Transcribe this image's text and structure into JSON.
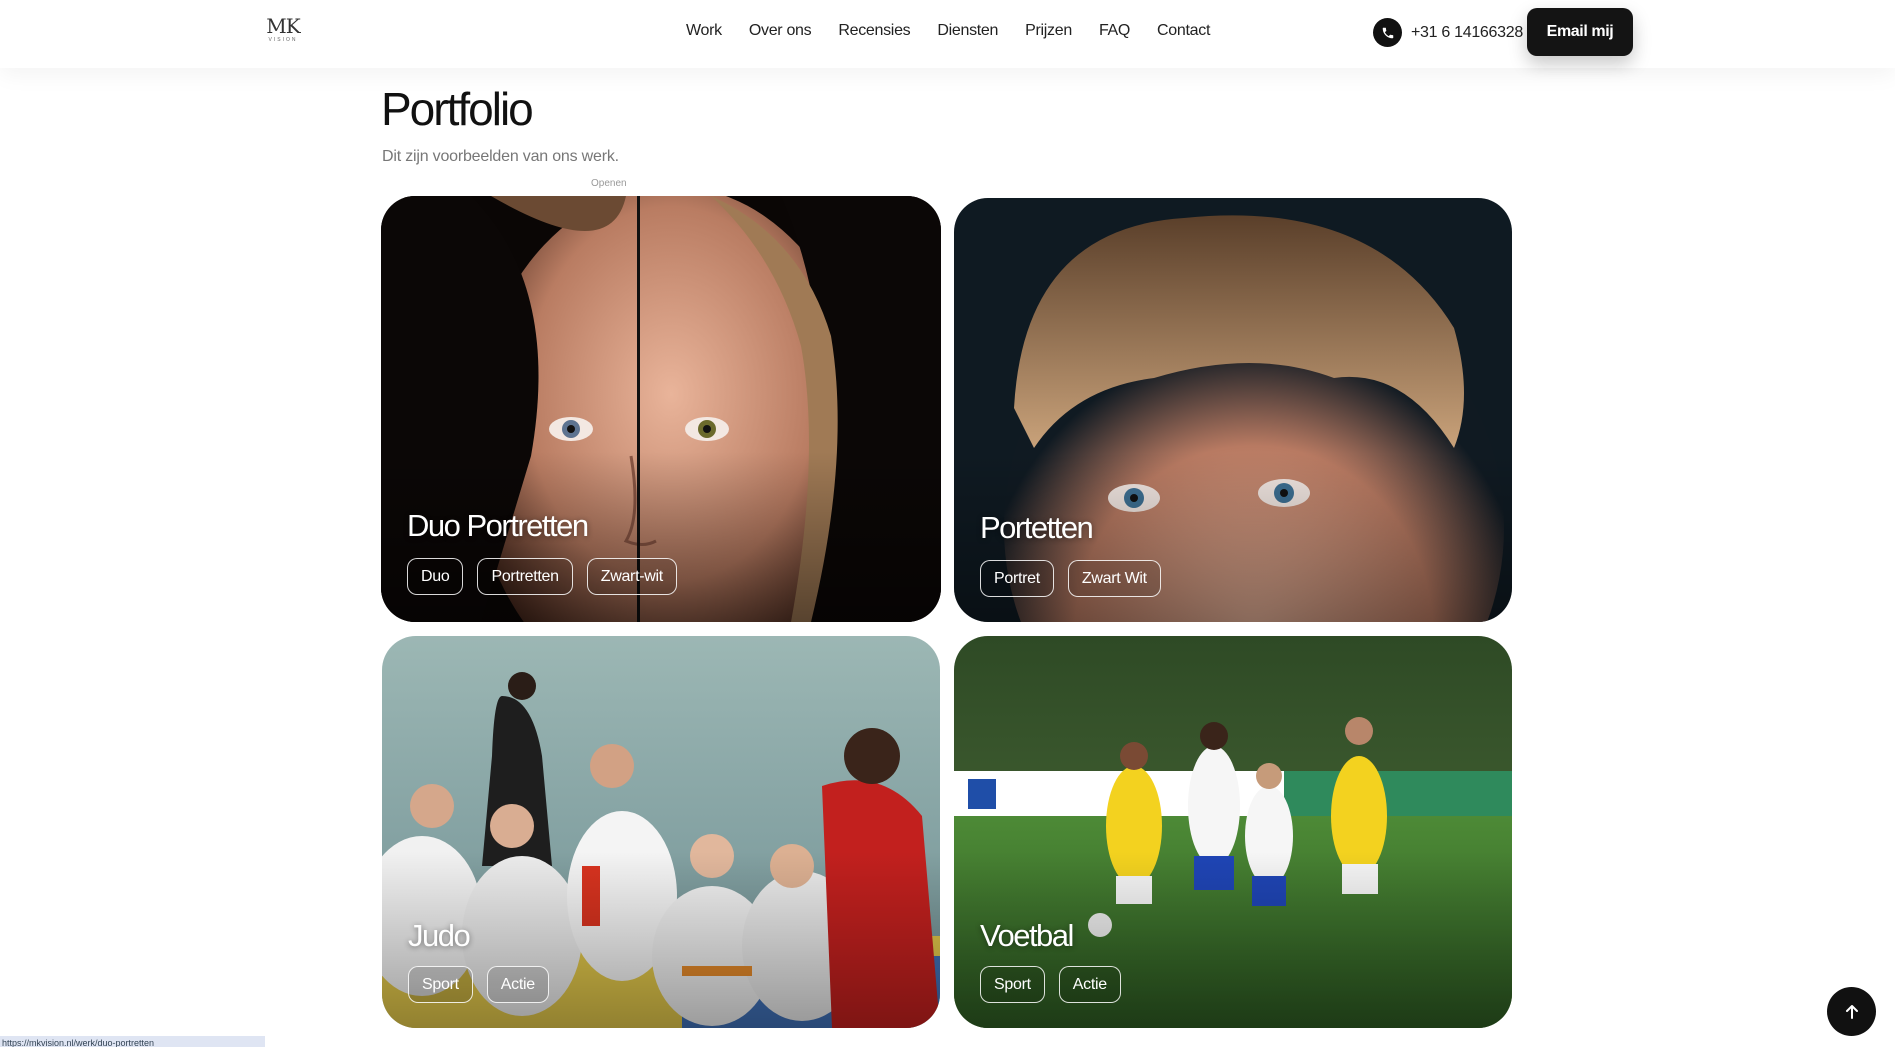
{
  "header": {
    "logo": "MK VISION",
    "nav": [
      "Work",
      "Over ons",
      "Recensies",
      "Diensten",
      "Prijzen",
      "FAQ",
      "Contact"
    ],
    "phone": "+31 6 14166328",
    "phone_icon": "phone-icon",
    "email_button": "Email mij"
  },
  "main": {
    "title": "Portfolio",
    "subtitle": "Dit zijn voorbeelden van ons werk.",
    "hover_hint": "Openen",
    "cards": [
      {
        "title": "Duo Portretten",
        "tags": [
          "Duo",
          "Portretten",
          "Zwart-wit"
        ]
      },
      {
        "title": "Portetten",
        "tags": [
          "Portret",
          "Zwart Wit"
        ]
      },
      {
        "title": "Judo",
        "tags": [
          "Sport",
          "Actie"
        ]
      },
      {
        "title": "Voetbal",
        "tags": [
          "Sport",
          "Actie"
        ]
      }
    ]
  },
  "scroll_top_icon": "arrow-up-icon",
  "status_bar": {
    "url": "https://mkvision.nl/werk/duo-portretten"
  }
}
